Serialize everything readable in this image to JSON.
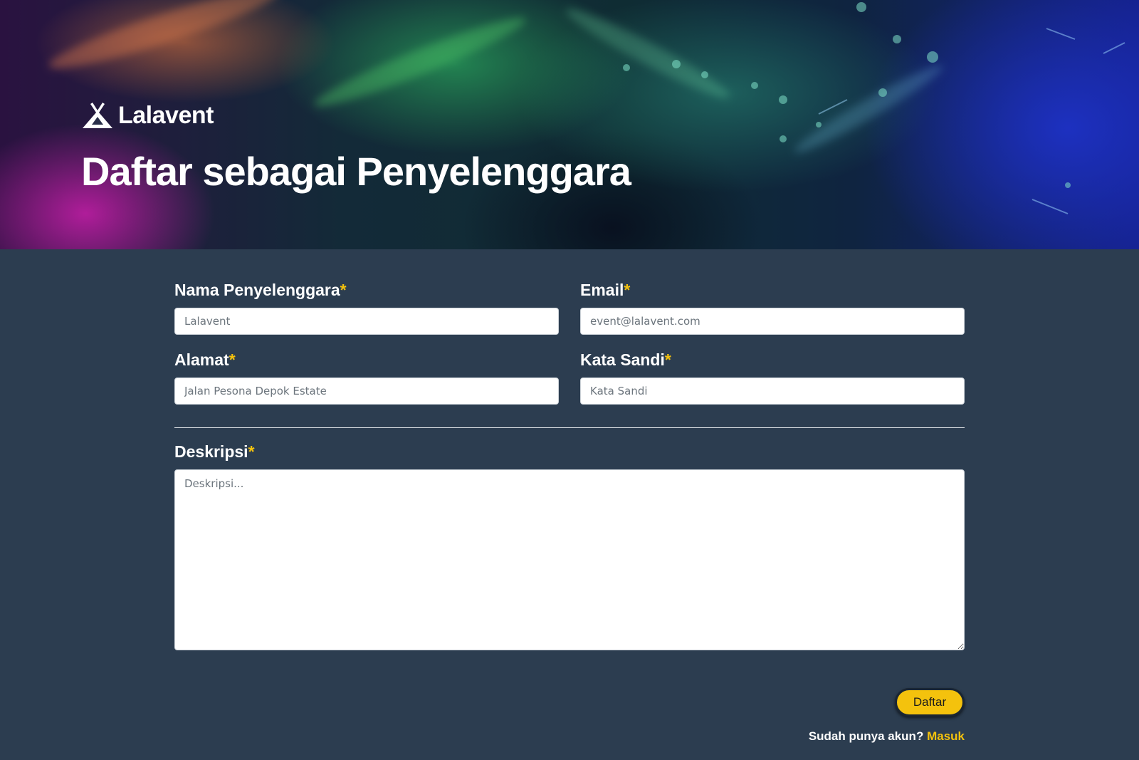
{
  "brand": {
    "name": "Lalavent",
    "logo_icon": "tent-icon"
  },
  "hero": {
    "title": "Daftar sebagai Penyelenggara"
  },
  "form": {
    "organizer_name": {
      "label": "Nama Penyelenggara",
      "required_mark": "*",
      "placeholder": "Lalavent",
      "value": ""
    },
    "email": {
      "label": "Email",
      "required_mark": "*",
      "placeholder": "event@lalavent.com",
      "value": ""
    },
    "address": {
      "label": "Alamat",
      "required_mark": "*",
      "placeholder": "Jalan Pesona Depok Estate",
      "value": ""
    },
    "password": {
      "label": "Kata Sandi",
      "required_mark": "*",
      "placeholder": "Kata Sandi",
      "value": ""
    },
    "description": {
      "label": "Deskripsi",
      "required_mark": "*",
      "placeholder": "Deskripsi...",
      "value": ""
    },
    "submit_label": "Daftar"
  },
  "footer": {
    "prompt": "Sudah punya akun?",
    "login_link": "Masuk"
  },
  "colors": {
    "accent": "#f4c20d",
    "background": "#2c3d50",
    "text": "#ffffff"
  }
}
